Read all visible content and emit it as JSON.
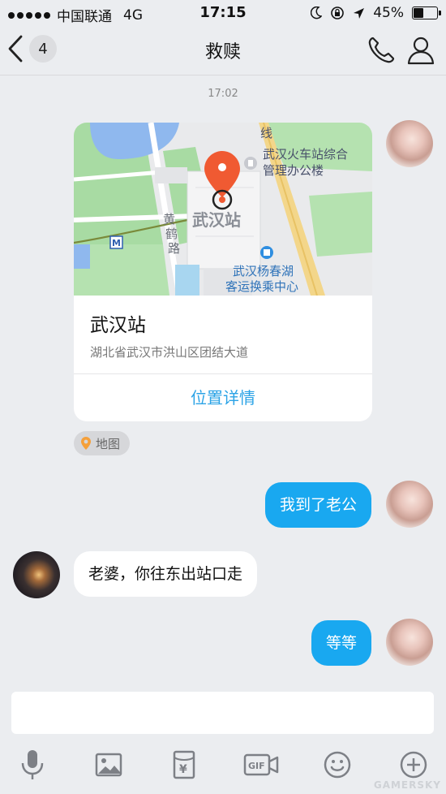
{
  "status_bar": {
    "carrier": "中国联通",
    "network": "4G",
    "time": "17:15",
    "battery": "45%",
    "battery_level": 0.45
  },
  "nav": {
    "back_count": "4",
    "title": "救赎"
  },
  "chat": {
    "timestamp": "17:02",
    "location_card": {
      "name": "武汉站",
      "address": "湖北省武汉市洪山区团结大道",
      "detail_link": "位置详情",
      "map_labels": {
        "office_line1": "武汉火车站综合",
        "office_line2": "管理办公楼",
        "station": "武汉站",
        "road_c1": "黄",
        "road_c2": "鹤",
        "road_c3": "路",
        "hub_line1": "武汉杨春湖",
        "hub_line2": "客运换乘中心",
        "line_fragment": "线"
      }
    },
    "map_tag": "地图",
    "messages": [
      {
        "from": "self",
        "text": "我到了老公"
      },
      {
        "from": "other",
        "text": "老婆，你往东出站口走"
      },
      {
        "from": "self",
        "text": "等等"
      }
    ]
  },
  "watermark": "GAMERSKY",
  "colors": {
    "accent": "#19a8f0",
    "link": "#2ba3e6",
    "map_pin": "#f05a32",
    "background": "#ebedf0"
  }
}
